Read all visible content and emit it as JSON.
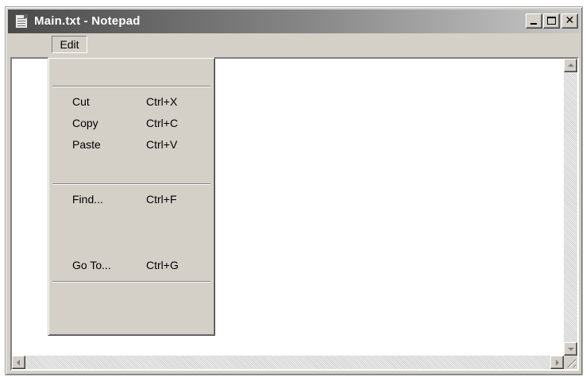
{
  "window": {
    "title": "Main.txt - Notepad",
    "icon": "notepad-icon",
    "controls": {
      "minimize_icon": "minimize-icon",
      "maximize_icon": "maximize-icon",
      "close_glyph": "✕"
    }
  },
  "menubar": {
    "items": [
      {
        "label": "Edit",
        "open": true
      }
    ]
  },
  "edit_menu": {
    "items": [
      {
        "label": "Cut",
        "shortcut": "Ctrl+X"
      },
      {
        "label": "Copy",
        "shortcut": "Ctrl+C"
      },
      {
        "label": "Paste",
        "shortcut": "Ctrl+V"
      },
      {
        "label": "Find...",
        "shortcut": "Ctrl+F"
      },
      {
        "label": "Go To...",
        "shortcut": "Ctrl+G"
      }
    ]
  },
  "editor": {
    "text": ""
  },
  "colors": {
    "face": "#d4d0c8",
    "title_gradient_start": "#4a4a4a",
    "title_gradient_end": "#c8c8c8",
    "editor_background": "#ffffff"
  }
}
